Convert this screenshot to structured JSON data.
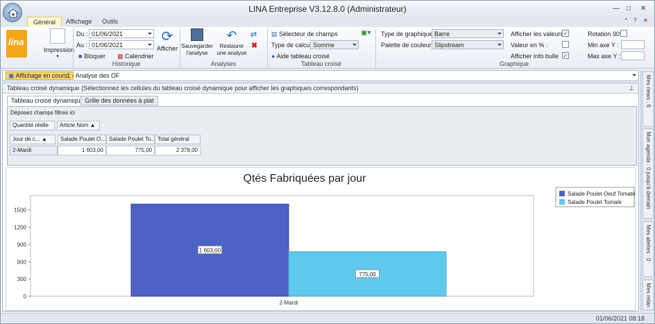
{
  "window": {
    "title": "LINA Entreprise  V3.12.8.0  (Administrateur)"
  },
  "tabs": [
    "Général",
    "Affichage",
    "Outils"
  ],
  "ribbon": {
    "logo_text": "lina",
    "impression": "Impression",
    "du_label": "Du :",
    "du_value": "01/06/2021",
    "au_label": "Au :",
    "au_value": "01/06/2021",
    "bloquer": "Bloquer",
    "calendrier": "Calendrier",
    "afficher": "Afficher",
    "historique": "Historique",
    "sauvegarder": "Sauvegarder l'analyse",
    "restaurer": "Restaurer une analyse",
    "analyses": "Analyses",
    "selecteur": "Sélecteur de champs",
    "type_calcul_label": "Type de calcul :",
    "type_calcul_value": "Somme",
    "aide": "Aide tableau croisé",
    "tableau_croise": "Tableau croisé",
    "type_graph_label": "Type de graphique :",
    "type_graph_value": "Barre",
    "palette_label": "Palette de couleurs :",
    "palette_value": "Slipstream",
    "afficher_valeurs": "Afficher les valeurs :",
    "valeur_pct": "Valeur en % :",
    "info_bulle": "Afficher info bulle",
    "rotation": "Rotation 90°",
    "min_axe": "Min axe Y :",
    "max_axe": "Max axe Y :",
    "graphique": "Graphique"
  },
  "current": {
    "label": "Affichage en cours :",
    "value": "1 - Analyse des OF"
  },
  "pivot": {
    "header": "Tableau croisé dynamique (Sélectionnez les cellules du tableau croisé dynamique pour afficher les graphiques correspondants)",
    "tab1": "Tableau croisé dynamique",
    "tab2": "Grille des données à plat",
    "filters": "Déposez champs filtres ici",
    "data_field": "Quantité réelle",
    "col_field": "Article Nom",
    "row_field": "Jour de c...",
    "col1": "Salade Poulet O...",
    "col2": "Salade Poulet To...",
    "col_total": "Total général",
    "row1": "2-Mardi",
    "v1": "1 603,00",
    "v2": "775,00",
    "vt": "2 378,00"
  },
  "right_tabs": [
    "Mes news : 6",
    "Mon agenda : 0 jusqu'à demain",
    "Mes alertes : 0",
    "Mes relan"
  ],
  "status": {
    "datetime": "01/06/2021 08:18"
  },
  "colors": {
    "series1": "#4c62c6",
    "series2": "#5ec8ee"
  },
  "chart_data": {
    "type": "bar",
    "title": "Qtés Fabriquées par jour",
    "categories": [
      "2-Mardi"
    ],
    "series": [
      {
        "name": "Salade Poulet Oeuf Tomate",
        "values": [
          1603
        ],
        "label": "1 603,00"
      },
      {
        "name": "Salade Poulet Tomate",
        "values": [
          775
        ],
        "label": "775,00"
      }
    ],
    "yticks": [
      0,
      300,
      600,
      900,
      1200,
      1500
    ],
    "ylim": [
      0,
      1750
    ],
    "legend": "top-right"
  }
}
